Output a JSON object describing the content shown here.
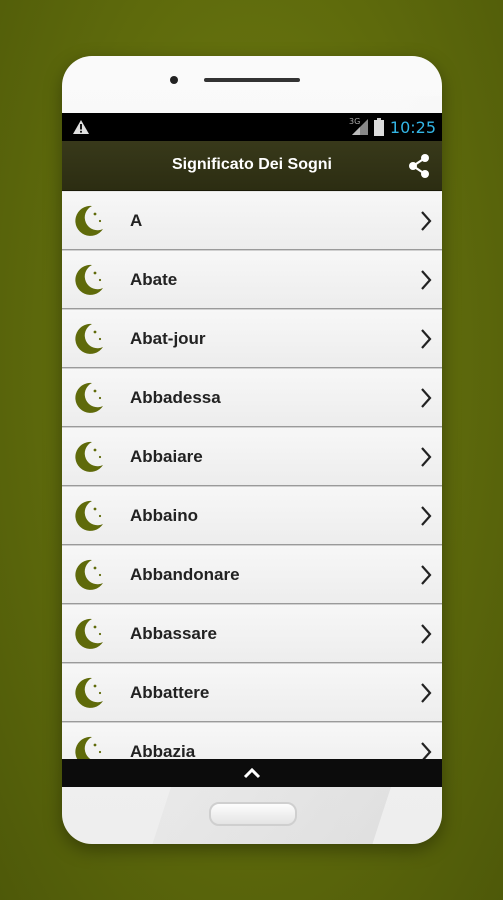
{
  "statusbar": {
    "time": "10:25",
    "network_label": "3G",
    "icons": [
      "warning-icon",
      "signal-icon",
      "battery-icon"
    ],
    "time_color": "#33b5e5"
  },
  "appbar": {
    "title": "Significato Dei Sogni",
    "share_icon": "share-icon",
    "background": "#2f3015"
  },
  "list": {
    "item_icon": "crescent-moon-icon",
    "accent": "#5f6a0a",
    "items": [
      {
        "label": "A"
      },
      {
        "label": "Abate"
      },
      {
        "label": "Abat-jour"
      },
      {
        "label": "Abbadessa"
      },
      {
        "label": "Abbaiare"
      },
      {
        "label": "Abbaino"
      },
      {
        "label": "Abbandonare"
      },
      {
        "label": "Abbassare"
      },
      {
        "label": "Abbattere"
      },
      {
        "label": "Abbazia"
      }
    ]
  },
  "bottombar": {
    "icon": "chevron-up-icon"
  }
}
